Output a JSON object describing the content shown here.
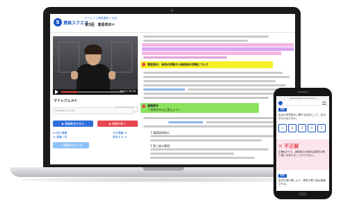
{
  "header": {
    "logo_mark": "S",
    "logo_text": "資格スクエア",
    "breadcrumb": "ホーム > 公務員講座 > 民法",
    "lesson_title": "第3回　意思表示①"
  },
  "video": {
    "time": "00:12 / 45:30",
    "progress": 0.27
  },
  "note": {
    "title": "マイレジュメ①",
    "meta": "2019/06/17 14:30",
    "speed_label": "1.0倍速 ▾"
  },
  "buttons": {
    "blue_label": "▶ 講義動画を見る",
    "red_label": "▶ 問題を解く"
  },
  "side_links": {
    "link1": "≫ 前の講義",
    "link2": "≫ 講義一覧",
    "link3": "次の講義 ≫",
    "link4": "質問する ≫",
    "light_button": "✓ 受講済みにする"
  },
  "text_panel": {
    "section1": "意思表示：有効の判断から無効体の判断について",
    "section2": "虚偽表示",
    "section2_sub": "〜判例を中心に覚えよう〜",
    "item1": "1 通謀虚偽表示",
    "item2": "2 第三者の範囲"
  },
  "phone": {
    "url": "www.shikaku-square.com",
    "tag1": "問題",
    "text1": "民法の意思表示に関する記述として、妥当なものはどれか。",
    "choices": [
      "1",
      "2",
      "3",
      "4",
      "5"
    ],
    "result": "✕ 不正解",
    "text2": "正解は3です。虚偽表示の無効は善意の第三者に対抗することができない。",
    "tag2": "解説",
    "text3": "民法94条2項により、善意の第三者は保護される。"
  },
  "colors": {
    "brand_blue": "#1a56c4",
    "accent_red": "#e64650",
    "highlight_pink": "#f4b5e6",
    "highlight_yellow": "#f6ef2a",
    "highlight_green": "#8be35c"
  }
}
